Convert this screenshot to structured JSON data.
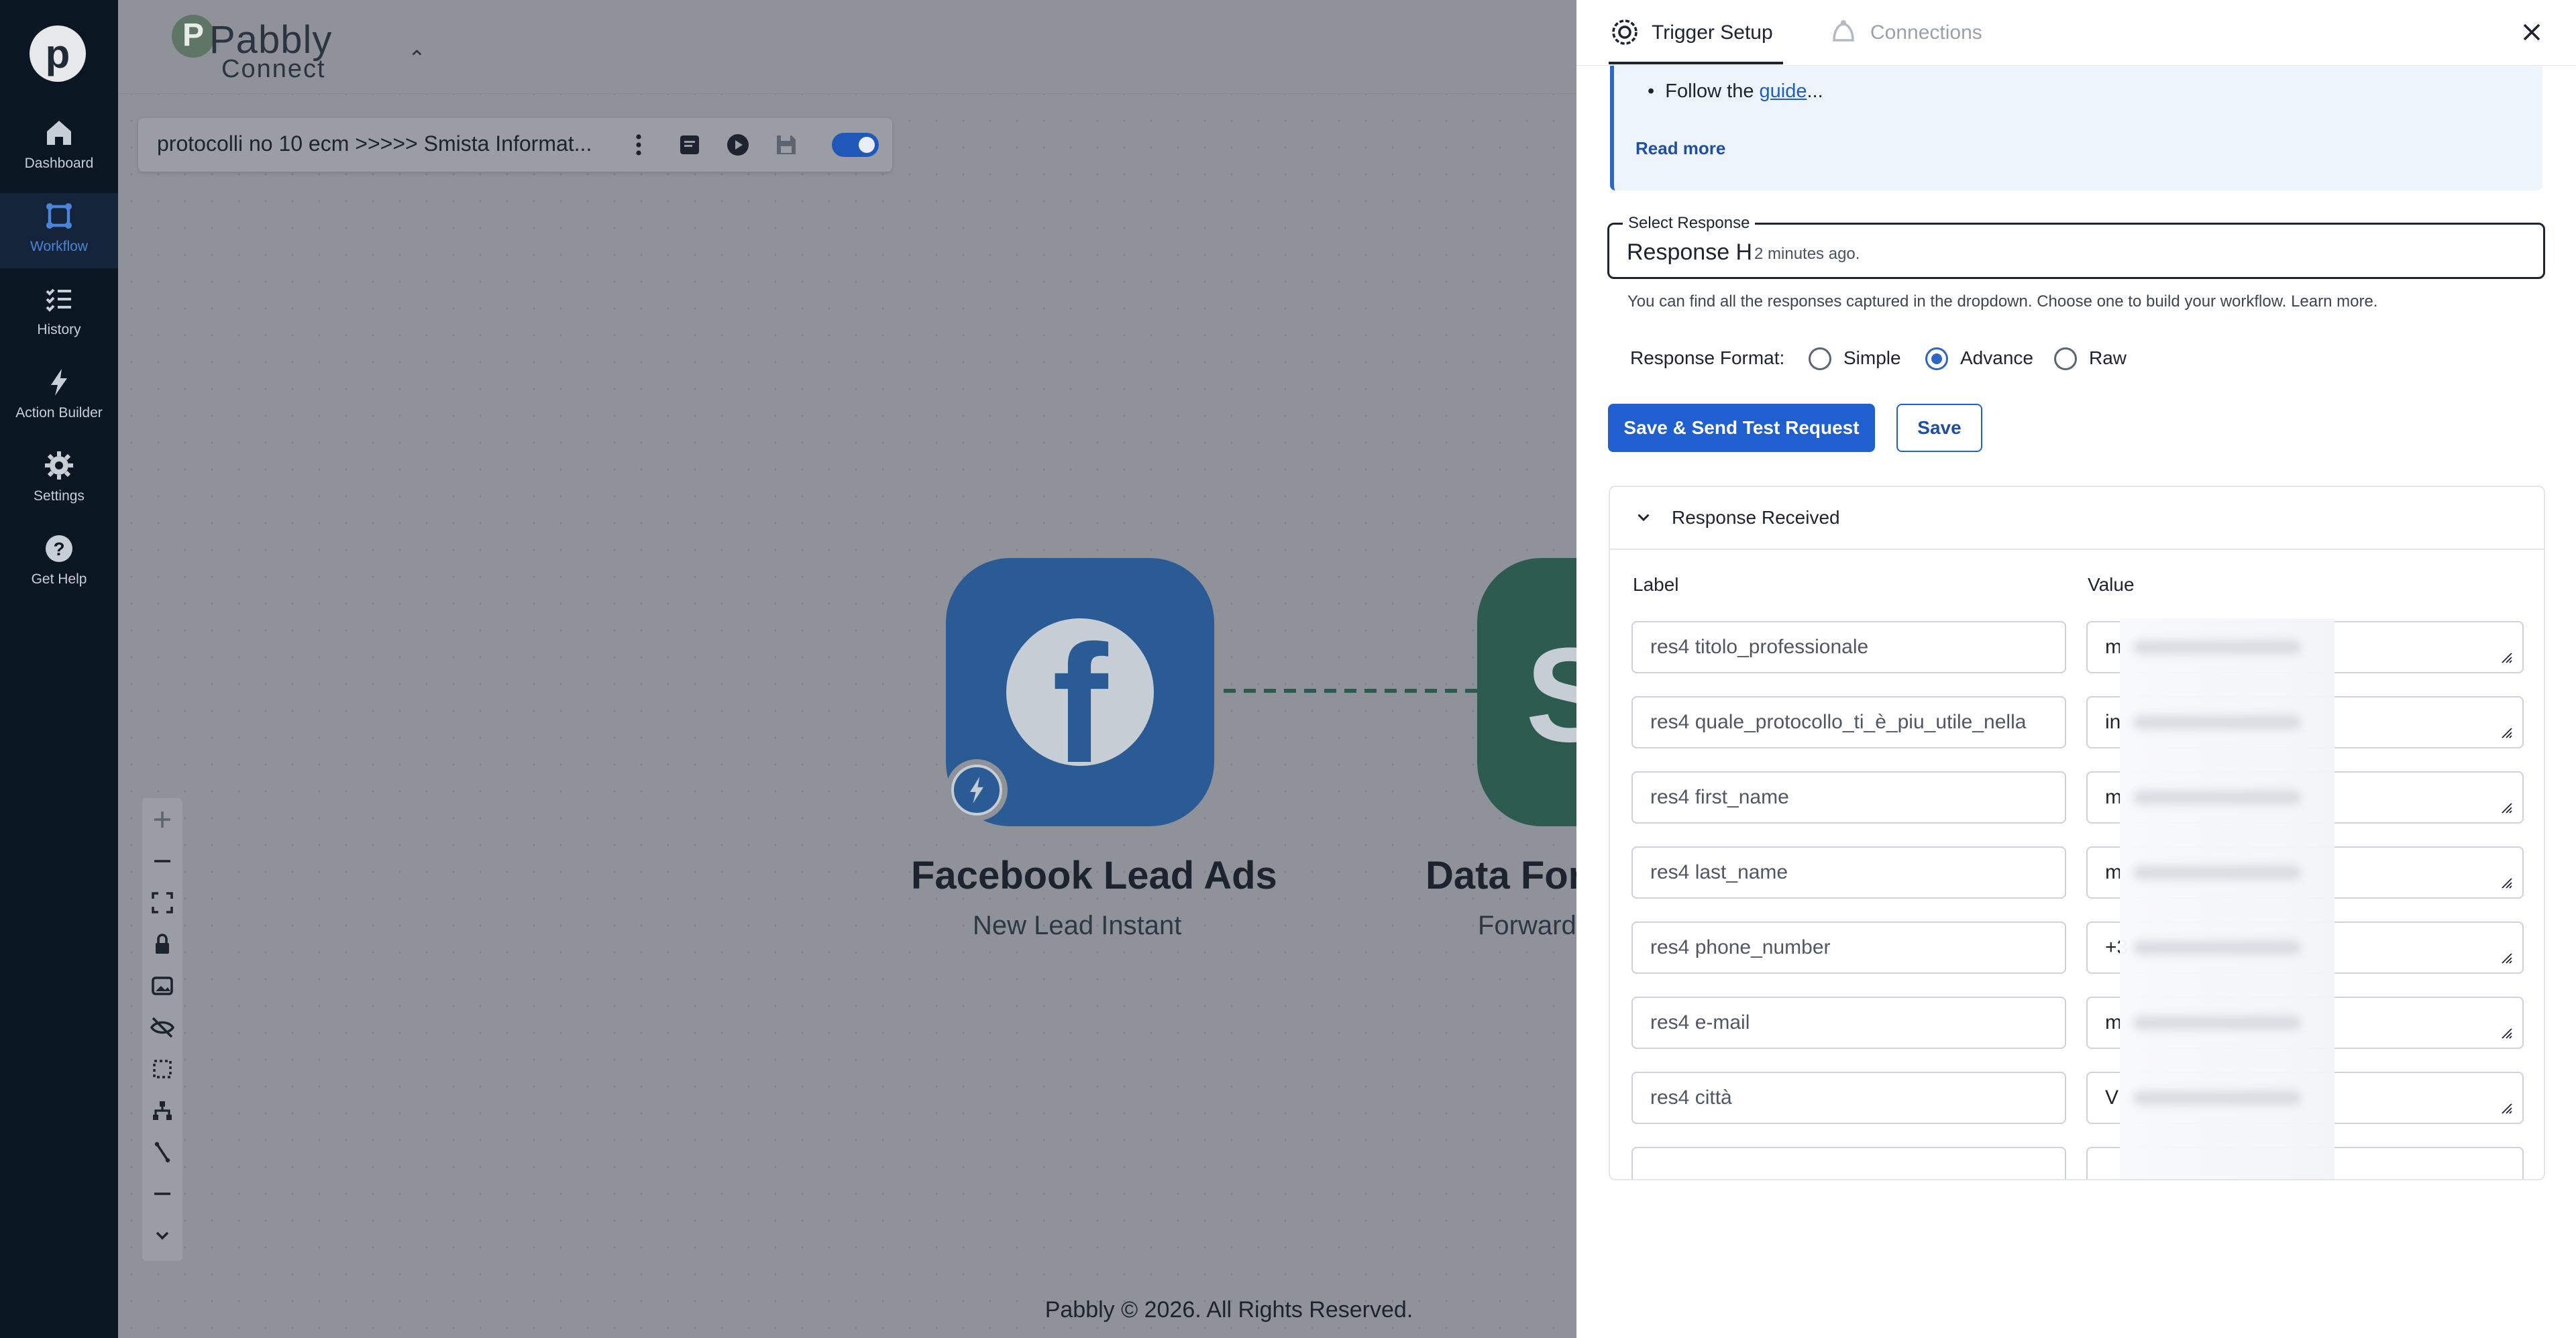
{
  "nav": {
    "logo_letter": "p",
    "items": [
      {
        "label": "Dashboard",
        "icon": "home-icon"
      },
      {
        "label": "Workflow",
        "icon": "workflow-icon",
        "active": true
      },
      {
        "label": "History",
        "icon": "history-list-icon"
      },
      {
        "label": "Action Builder",
        "icon": "bolt-icon"
      },
      {
        "label": "Settings",
        "icon": "gear-icon"
      },
      {
        "label": "Get Help",
        "icon": "help-icon"
      }
    ]
  },
  "brand": {
    "name": "Pabbly",
    "product": "Connect"
  },
  "workflow": {
    "title": "protocolli no 10 ecm  >>>>>  Smista Informat...",
    "enabled": true
  },
  "nodes": {
    "trigger": {
      "app": "Facebook Lead Ads",
      "event": "New Lead Instant"
    },
    "action": {
      "app": "Data For",
      "event": "Forward"
    }
  },
  "footer": "Pabbly © 2026. All Rights Reserved.",
  "panel": {
    "tabs": [
      {
        "label": "Trigger Setup",
        "active": true
      },
      {
        "label": "Connections",
        "active": false
      }
    ],
    "info": {
      "bullet_prefix": "Follow the ",
      "link": "guide",
      "bullet_suffix": "...",
      "read_more": "Read more"
    },
    "select_response": {
      "legend": "Select Response",
      "value": "Response H",
      "age": "2 minutes ago."
    },
    "helper_text": "You can find all the responses captured in the dropdown. Choose one to build your workflow. Learn more.",
    "response_format": {
      "label": "Response Format:",
      "options": [
        "Simple",
        "Advance",
        "Raw"
      ],
      "selected": "Advance"
    },
    "buttons": {
      "send": "Save & Send Test Request",
      "save": "Save"
    },
    "response": {
      "title": "Response Received",
      "col_label": "Label",
      "col_value": "Value",
      "rows": [
        {
          "label": "res4 titolo_professionale",
          "value": "m"
        },
        {
          "label": "res4 quale_protocollo_ti_è_piu_utile_nella",
          "value": "in"
        },
        {
          "label": "res4 first_name",
          "value": "m"
        },
        {
          "label": "res4 last_name",
          "value": "m"
        },
        {
          "label": "res4 phone_number",
          "value": "+3"
        },
        {
          "label": "res4 e-mail",
          "value": "m"
        },
        {
          "label": "res4 città",
          "value": "V"
        }
      ]
    }
  },
  "colors": {
    "accent": "#1f5fd0",
    "rail": "#0b1623",
    "facebook": "#2a5b95",
    "data_forwarder": "#2d5b50"
  }
}
